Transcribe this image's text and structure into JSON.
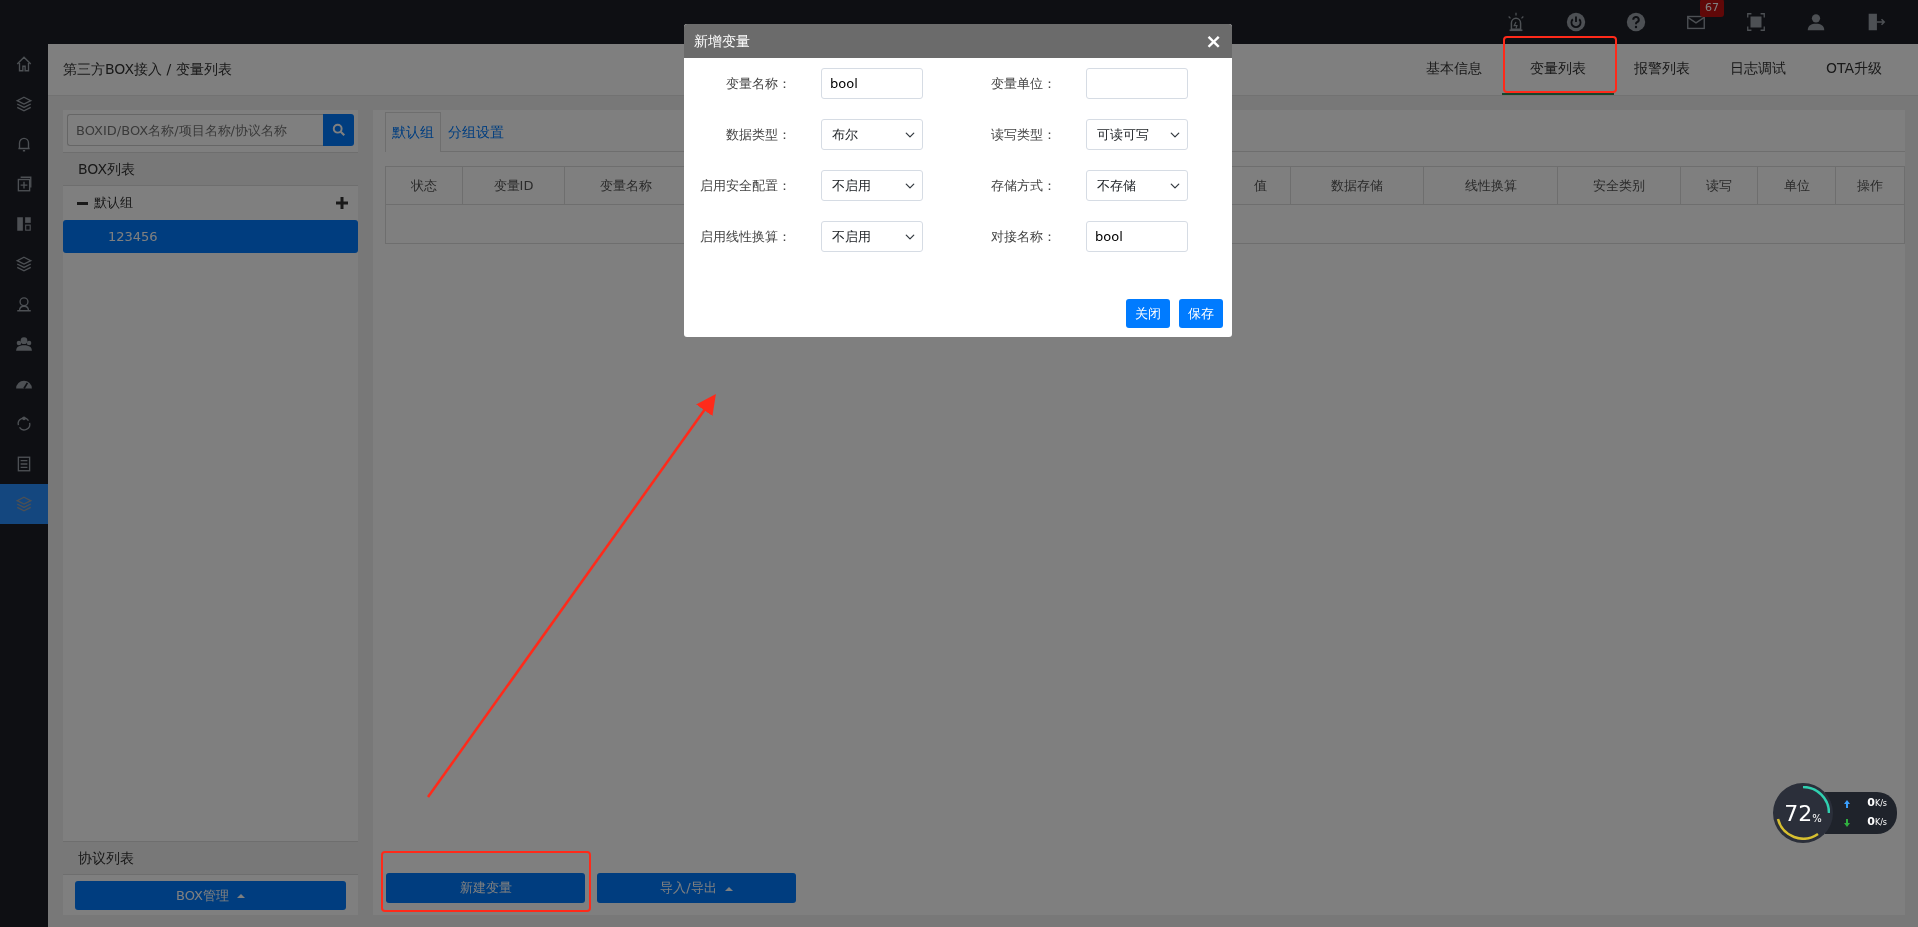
{
  "header": {
    "notification_badge": "67"
  },
  "sidebar": {
    "items": [
      {
        "selected": false
      },
      {
        "selected": false
      },
      {
        "selected": false
      },
      {
        "selected": false
      },
      {
        "selected": false
      },
      {
        "selected": false
      },
      {
        "selected": false
      },
      {
        "selected": false
      },
      {
        "selected": false
      },
      {
        "selected": false
      },
      {
        "selected": false
      },
      {
        "selected": true
      }
    ]
  },
  "breadcrumb": "第三方BOX接入 / 变量列表",
  "nav_tabs": [
    {
      "label": "基本信息",
      "selected": false
    },
    {
      "label": "变量列表",
      "selected": true
    },
    {
      "label": "报警列表",
      "selected": false
    },
    {
      "label": "日志调试",
      "selected": false
    },
    {
      "label": "OTA升级",
      "selected": false
    }
  ],
  "box_panel": {
    "search": {
      "placeholder": "BOXID/BOX名称/项目名称/协议名称"
    },
    "box_list_title": "BOX列表",
    "groups": [
      {
        "label": "默认组",
        "expanded": true,
        "children": [
          {
            "label": "123456",
            "selected": true
          }
        ]
      }
    ],
    "protocol_list_title": "协议列表",
    "manage_button": {
      "label": "BOX管理",
      "caret": true
    }
  },
  "variable_panel": {
    "tabs": [
      {
        "label": "默认组",
        "selected": true
      },
      {
        "label": "分组设置",
        "selected": false
      }
    ],
    "table": {
      "columns": [
        "状态",
        "变量ID",
        "变量名称",
        "值",
        "数据存储",
        "线性换算",
        "安全类别",
        "读写",
        "单位",
        "操作"
      ]
    },
    "buttons": [
      {
        "label": "新建变量",
        "caret": false
      },
      {
        "label": "导入/导出",
        "caret": true
      }
    ]
  },
  "modal": {
    "title": "新增变量",
    "close": "×",
    "fields": [
      {
        "label": "变量名称：",
        "kind": "input",
        "value": "bool"
      },
      {
        "label": "变量单位：",
        "kind": "input"
      },
      {
        "label": "数据类型：",
        "kind": "select",
        "value": "布尔"
      },
      {
        "label": "读写类型：",
        "kind": "select",
        "value": "可读可写"
      },
      {
        "label": "启用安全配置：",
        "kind": "select",
        "value": "不启用"
      },
      {
        "label": "存储方式：",
        "kind": "select",
        "value": "不存储"
      },
      {
        "label": "启用线性换算：",
        "kind": "select",
        "value": "不启用"
      },
      {
        "label": "对接名称：",
        "kind": "input",
        "value": "bool"
      }
    ],
    "buttons": [
      "关闭",
      "保存"
    ]
  },
  "speed_widget": {
    "percent": "72",
    "percent_sign": "%",
    "upload": "0",
    "upload_unit": "K/s",
    "download": "0",
    "download_unit": "K/s"
  }
}
